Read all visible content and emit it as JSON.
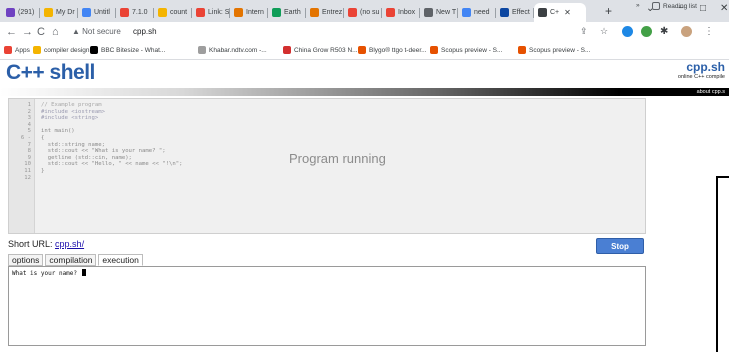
{
  "browser": {
    "tabs": [
      {
        "label": "(291)",
        "color": "#6f42c1"
      },
      {
        "label": "My Dr",
        "color": "#f4b400"
      },
      {
        "label": "Untitl",
        "color": "#4285f4"
      },
      {
        "label": "7.1.0",
        "color": "#ea4335"
      },
      {
        "label": "count",
        "color": "#f4b400"
      },
      {
        "label": "Link: S",
        "color": "#ea4335"
      },
      {
        "label": "Intern",
        "color": "#e37400"
      },
      {
        "label": "Earth",
        "color": "#0f9d58"
      },
      {
        "label": "Entrez",
        "color": "#e37400"
      },
      {
        "label": "(no su",
        "color": "#ea4335"
      },
      {
        "label": "Inbox",
        "color": "#ea4335"
      },
      {
        "label": "New T",
        "color": "#5f6368"
      },
      {
        "label": "need",
        "color": "#4285f4"
      },
      {
        "label": "Effect",
        "color": "#0d47a1"
      },
      {
        "label": "C+",
        "color": "#3c4043"
      }
    ],
    "security_label": "Not secure",
    "url": "cpp.sh",
    "bookmarks": [
      {
        "label": "Apps",
        "color": "#ea4335"
      },
      {
        "label": "compiler design",
        "color": "#f4b400"
      },
      {
        "label": "BBC Bitesize - What...",
        "color": "#000000"
      },
      {
        "label": "Khabar.ndtv.com -...",
        "color": "#9e9e9e"
      },
      {
        "label": "China Grow R503 N...",
        "color": "#d32f2f"
      },
      {
        "label": "Blygo® ttgo t-deer...",
        "color": "#e65100"
      },
      {
        "label": "Scopus preview - S...",
        "color": "#e65100"
      },
      {
        "label": "Scopus preview - S...",
        "color": "#e65100"
      }
    ],
    "reading_list": "Reading list"
  },
  "site": {
    "logo": "C++ shell",
    "logo_right": "cpp.sh",
    "tagline": "online C++ compile",
    "about": "about cpp.s"
  },
  "editor": {
    "line_numbers": [
      "1",
      "2",
      "3",
      "4",
      "5",
      "6 -",
      "7",
      "8",
      "9",
      "10",
      "11",
      "12"
    ],
    "lines": [
      "// Example program",
      "#include <iostream>",
      "#include <string>",
      "",
      "int main()",
      "{",
      "  std::string name;",
      "  std::cout << \"What is your name? \";",
      "  getline (std::cin, name);",
      "  std::cout << \"Hello, \" << name << \"!\\n\";",
      "}",
      ""
    ],
    "status": "Program running"
  },
  "short_url": {
    "label": "Short URL:",
    "link": "cpp.sh/"
  },
  "stop_label": "Stop",
  "tabs": [
    "options",
    "compilation",
    "execution"
  ],
  "console_output": "What is your name? "
}
